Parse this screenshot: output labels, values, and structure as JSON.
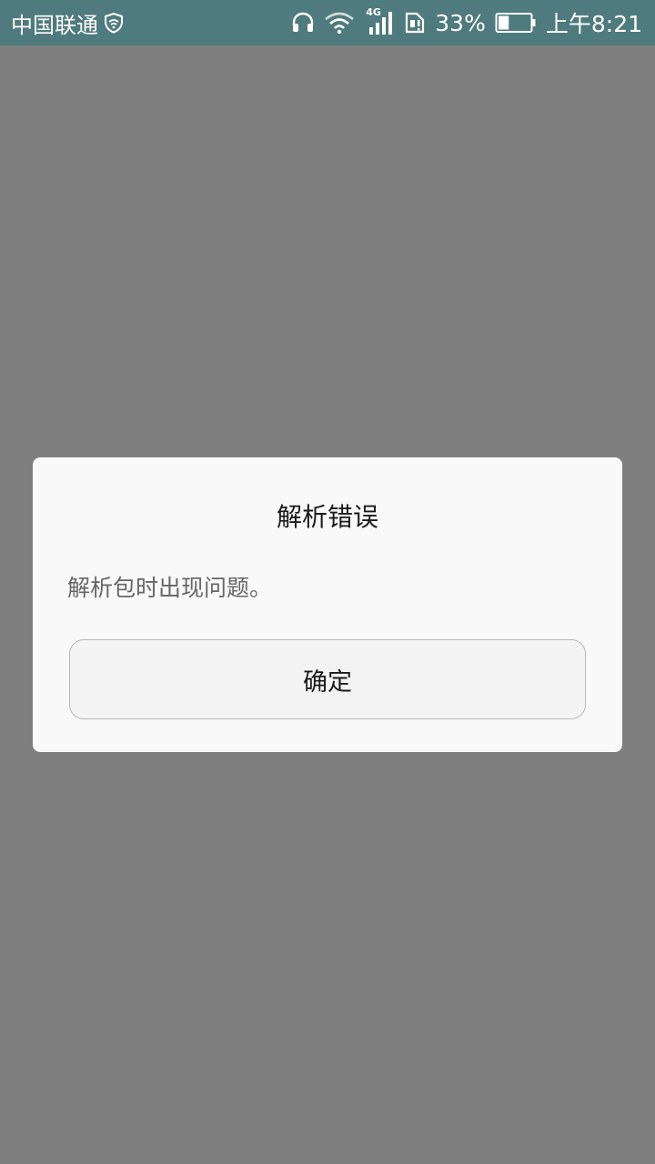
{
  "status_bar": {
    "carrier": "中国联通",
    "network_type": "4G",
    "battery_percent": "33%",
    "battery_level": 0.33,
    "time": "上午8:21",
    "icons": [
      "vpn-shield-icon",
      "headphones-icon",
      "wifi-icon",
      "signal-icon",
      "sim-alert-icon",
      "battery-icon"
    ],
    "color": "#4f7b7e"
  },
  "dialog": {
    "title": "解析错误",
    "message": "解析包时出现问题。",
    "ok_label": "确定"
  },
  "colors": {
    "overlay": "#7f7f7f",
    "dialog_bg": "#f9f9f9",
    "button_border": "#b8b8b8"
  }
}
